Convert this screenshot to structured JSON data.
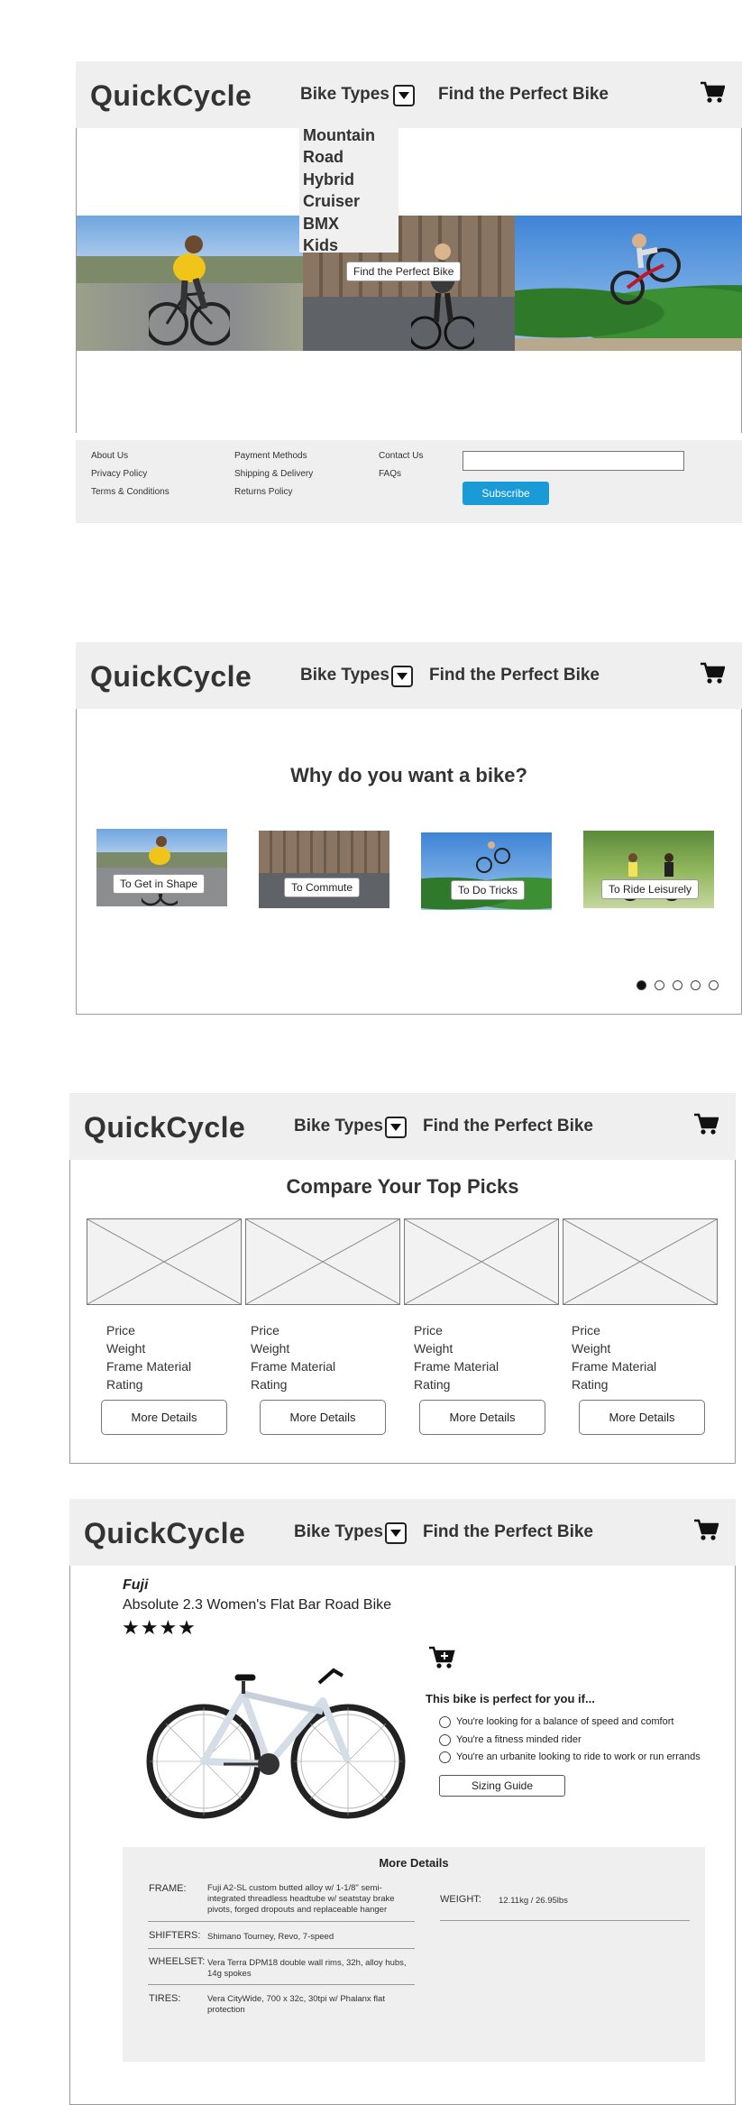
{
  "brand": "QuickCycle",
  "nav": {
    "bike_types": "Bike Types",
    "find": "Find the Perfect Bike"
  },
  "dropdown": [
    "Mountain",
    "Road",
    "Hybrid",
    "Cruiser",
    "BMX",
    "Kids"
  ],
  "hero": {
    "button": "Find the Perfect Bike"
  },
  "footer": {
    "col1": [
      "About Us",
      "Privacy Policy",
      "Terms & Conditions"
    ],
    "col2": [
      "Payment Methods",
      "Shipping & Delivery",
      "Returns Policy"
    ],
    "col3": [
      "Contact Us",
      "FAQs"
    ],
    "email_placeholder": "",
    "subscribe": "Subscribe"
  },
  "why": {
    "title": "Why do you want a bike?",
    "options": [
      "To Get in Shape",
      "To Commute",
      "To Do Tricks",
      "To Ride Leisurely"
    ],
    "carousel_active": 0,
    "carousel_count": 5
  },
  "compare": {
    "title": "Compare Your Top Picks",
    "specs": [
      "Price",
      "Weight",
      "Frame Material",
      "Rating"
    ],
    "button": "More Details",
    "count": 4
  },
  "product": {
    "brand": "Fuji",
    "name": "Absolute 2.3 Women's Flat Bar Road Bike",
    "rating_stars": 4,
    "stars_text": "★★★★",
    "perfect_title": "This bike is perfect for you if...",
    "reasons": [
      "You're looking for a balance of speed and comfort",
      "You're a fitness minded rider",
      "You're an urbanite looking to ride to work or run errands"
    ],
    "sizing_button": "Sizing Guide",
    "details_title": "More Details",
    "specs": [
      {
        "label": "FRAME:",
        "value": "Fuji A2-SL custom butted alloy w/ 1-1/8\" semi-integrated threadless headtube w/ seatstay brake pivots, forged dropouts and replaceable hanger"
      },
      {
        "label": "SHIFTERS:",
        "value": "Shimano Tourney, Revo, 7-speed"
      },
      {
        "label": "WHEELSET:",
        "value": "Vera Terra DPM18 double wall rims, 32h, alloy hubs, 14g spokes"
      },
      {
        "label": "TIRES:",
        "value": "Vera CityWide, 700 x 32c, 30tpi w/ Phalanx flat protection"
      }
    ],
    "weight": {
      "label": "WEIGHT:",
      "value": "12.11kg / 26.95lbs"
    }
  },
  "colors": {
    "header_bg": "#efefef",
    "subscribe": "#1a9bd7",
    "panel_border": "#9a9a9a"
  }
}
